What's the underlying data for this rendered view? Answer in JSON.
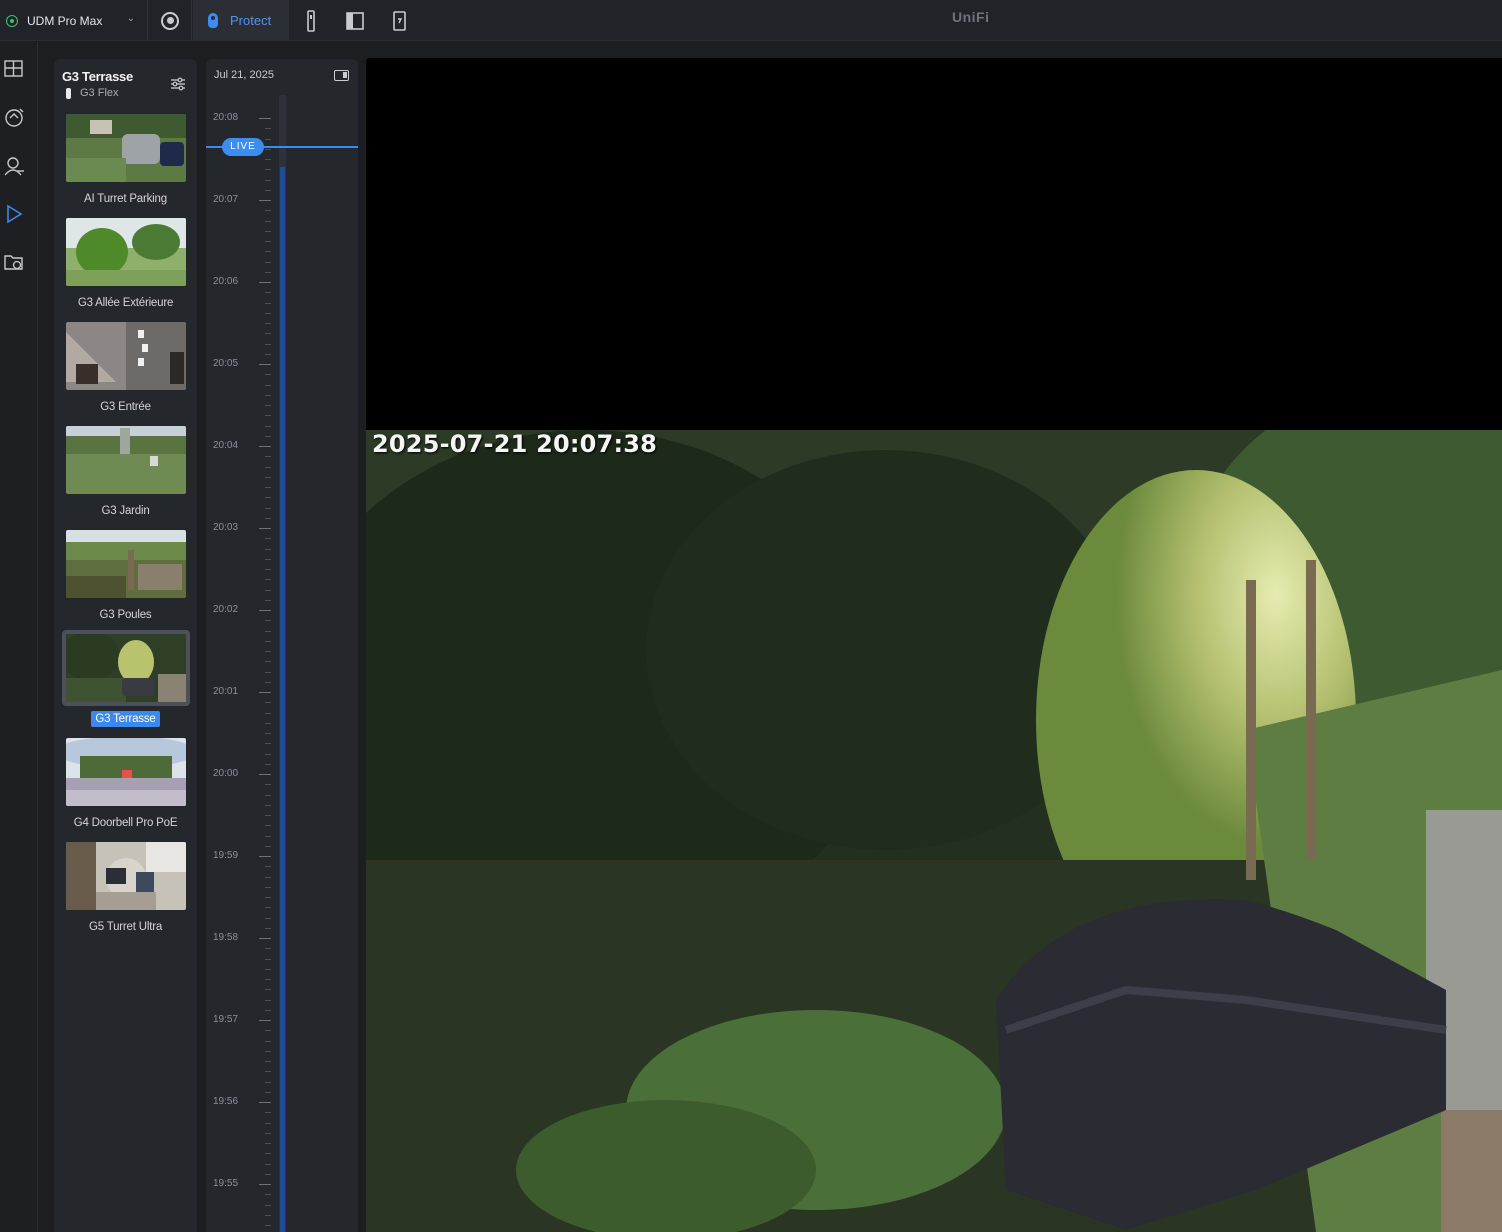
{
  "header": {
    "console_name": "UDM Pro Max",
    "app_label": "Protect",
    "brand": "UniFi"
  },
  "camera_panel": {
    "title": "G3 Terrasse",
    "subtitle": "G3 Flex",
    "cameras": [
      {
        "name": "AI Turret Parking",
        "selected": false
      },
      {
        "name": "G3 Allée Extérieure",
        "selected": false
      },
      {
        "name": "G3 Entrée",
        "selected": false
      },
      {
        "name": "G3 Jardin",
        "selected": false
      },
      {
        "name": "G3 Poules",
        "selected": false
      },
      {
        "name": "G3 Terrasse",
        "selected": true
      },
      {
        "name": "G4 Doorbell Pro PoE",
        "selected": false
      },
      {
        "name": "G5 Turret Ultra",
        "selected": false
      }
    ]
  },
  "timeline": {
    "date": "Jul 21, 2025",
    "live_label": "LIVE",
    "times": [
      "20:08",
      "20:07",
      "20:06",
      "20:05",
      "20:04",
      "20:03",
      "20:02",
      "20:01",
      "20:00",
      "19:59",
      "19:58",
      "19:57",
      "19:56",
      "19:55"
    ]
  },
  "player": {
    "timestamp": "2025-07-21  20:07:38"
  },
  "colors": {
    "accent": "#3c89ec",
    "status_online": "#3ac46f"
  }
}
